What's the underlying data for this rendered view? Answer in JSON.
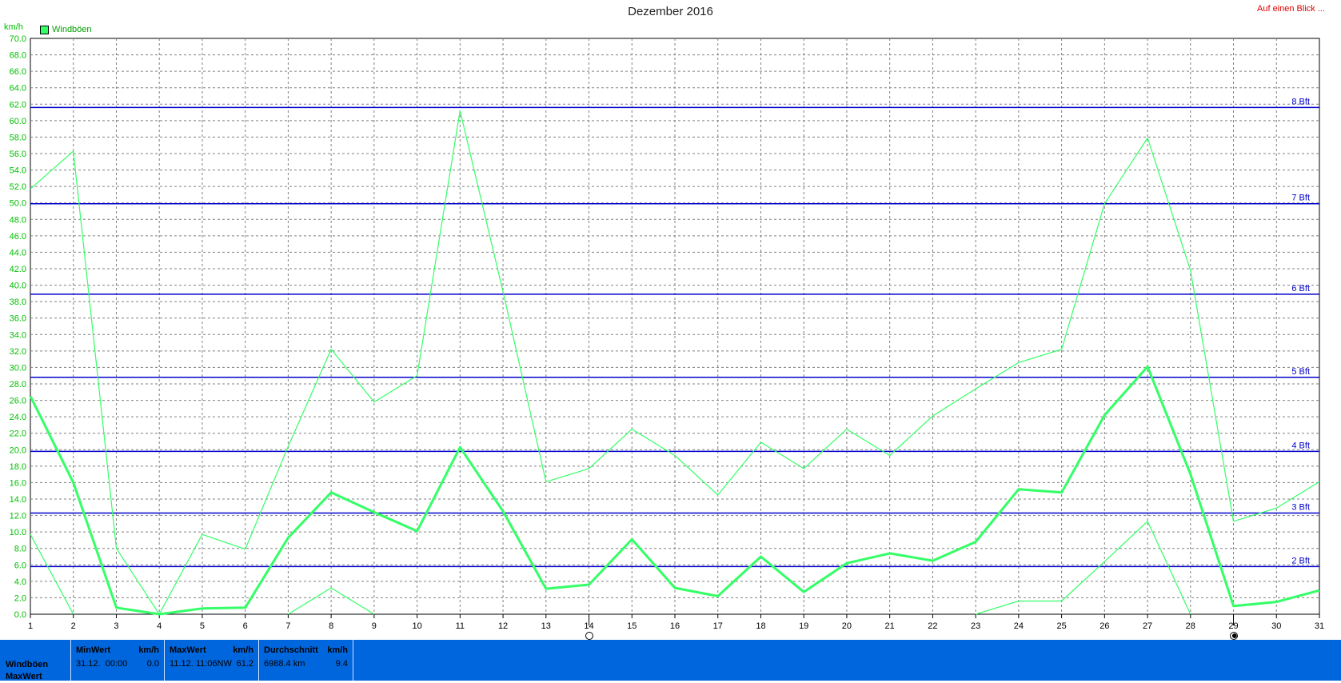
{
  "title": "Dezember 2016",
  "top_right_link": "Auf einen Blick ...",
  "y_unit_label": "km/h",
  "legend_label": "Windböen",
  "colors": {
    "series": "#33ff66",
    "beaufort_lines": "#0000cc",
    "grid": "#808080",
    "footer_bg": "#0066dd"
  },
  "chart_data": {
    "type": "line",
    "ylim": [
      0,
      70
    ],
    "y_ticks": [
      "0.0",
      "2.0",
      "4.0",
      "6.0",
      "8.0",
      "10.0",
      "12.0",
      "14.0",
      "16.0",
      "18.0",
      "20.0",
      "22.0",
      "24.0",
      "26.0",
      "28.0",
      "30.0",
      "32.0",
      "34.0",
      "36.0",
      "38.0",
      "40.0",
      "42.0",
      "44.0",
      "46.0",
      "48.0",
      "50.0",
      "52.0",
      "54.0",
      "56.0",
      "58.0",
      "60.0",
      "62.0",
      "64.0",
      "66.0",
      "68.0",
      "70.0"
    ],
    "x_ticks": [
      "1",
      "2",
      "3",
      "4",
      "5",
      "6",
      "7",
      "8",
      "9",
      "10",
      "11",
      "12",
      "13",
      "14",
      "15",
      "16",
      "17",
      "18",
      "19",
      "20",
      "21",
      "22",
      "23",
      "24",
      "25",
      "26",
      "27",
      "28",
      "29",
      "30",
      "31"
    ],
    "grid": true,
    "series": [
      {
        "name": "Windböen",
        "style": "bold",
        "values": [
          26.5,
          16.0,
          0.8,
          0.0,
          0.7,
          0.8,
          9.3,
          14.8,
          12.4,
          10.1,
          20.3,
          12.5,
          3.1,
          3.6,
          9.1,
          3.2,
          2.2,
          7.0,
          2.7,
          6.2,
          7.4,
          6.5,
          8.8,
          15.2,
          14.8,
          24.2,
          30.1,
          17.0,
          1.0,
          1.5,
          2.9
        ]
      },
      {
        "style": "thin",
        "values": [
          51.7,
          56.3,
          8.0,
          0.0,
          9.7,
          7.9,
          20.4,
          32.2,
          25.8,
          29.0,
          61.2,
          39.2,
          16.1,
          17.7,
          22.5,
          19.3,
          14.5,
          20.9,
          17.7,
          22.5,
          19.3,
          24.1,
          27.4,
          30.6,
          32.2,
          49.9,
          57.9,
          41.8,
          11.3,
          12.9,
          16.1
        ]
      },
      {
        "style": "thin",
        "values": [
          9.7,
          0.0,
          null,
          null,
          null,
          null,
          0.0,
          3.2,
          0.0,
          null,
          null,
          null,
          null,
          null,
          null,
          null,
          null,
          null,
          null,
          null,
          null,
          null,
          0.0,
          1.6,
          1.6,
          6.4,
          11.3,
          0.0,
          null,
          null,
          null
        ]
      }
    ],
    "beaufort_lines": [
      {
        "label": "2 Bft",
        "value": 5.8
      },
      {
        "label": "3 Bft",
        "value": 12.3
      },
      {
        "label": "4 Bft",
        "value": 19.8
      },
      {
        "label": "5 Bft",
        "value": 28.8
      },
      {
        "label": "6 Bft",
        "value": 38.9
      },
      {
        "label": "7 Bft",
        "value": 49.9
      },
      {
        "label": "8 Bft",
        "value": 61.6
      }
    ],
    "moon_markers": [
      {
        "day": 14,
        "phase": "full"
      },
      {
        "day": 29,
        "phase": "new"
      }
    ]
  },
  "footer": {
    "row_labels": [
      "Windböen",
      "MaxWert"
    ],
    "min": {
      "header": "MinWert",
      "unit": "km/h",
      "date": "31.12.",
      "time": "00:00",
      "value": "0.0"
    },
    "max": {
      "header": "MaxWert",
      "unit": "km/h",
      "datetime": "11.12.  11:06",
      "direction": "NW",
      "value": "61.2"
    },
    "avg": {
      "header": "Durchschnitt",
      "unit": "km/h",
      "total": "6988.4 km",
      "value": "9.4"
    }
  }
}
